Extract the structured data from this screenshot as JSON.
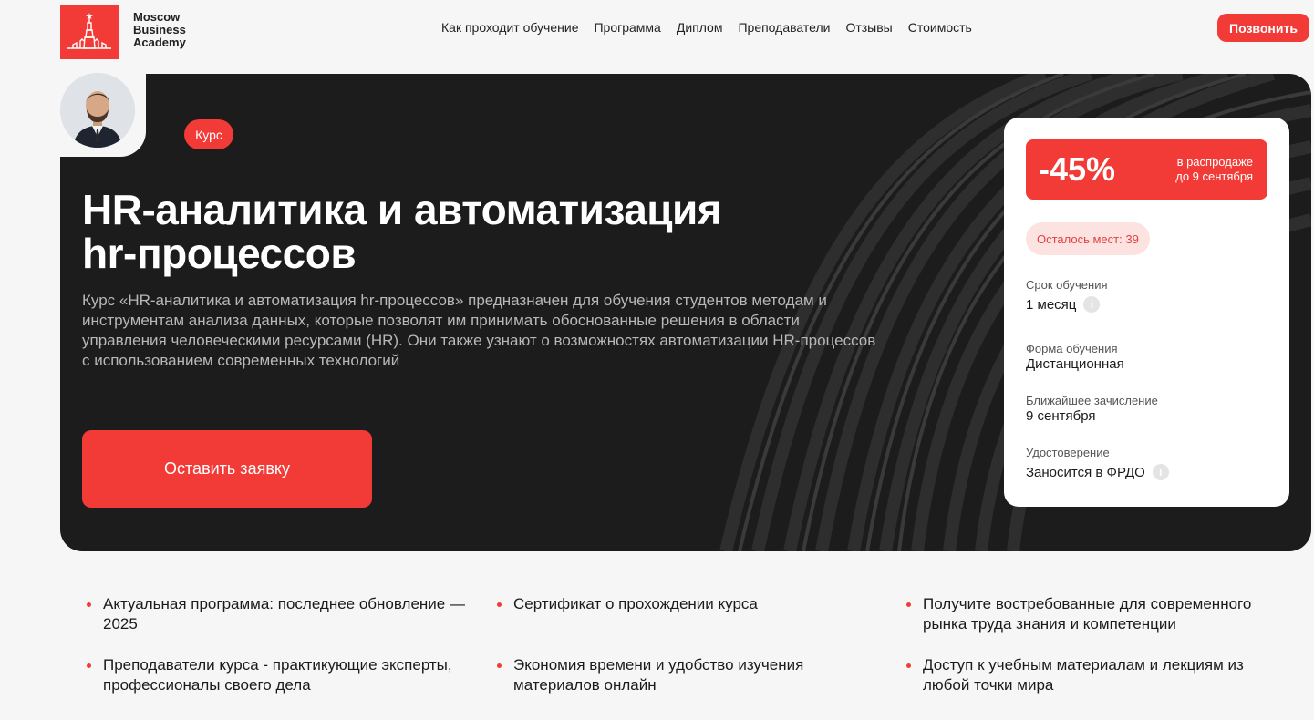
{
  "brand": {
    "line1": "Moscow",
    "line2": "Business",
    "line3": "Academy",
    "color": "#f23a37"
  },
  "nav": [
    {
      "label": "Как проходит обучение"
    },
    {
      "label": "Программа"
    },
    {
      "label": "Диплом"
    },
    {
      "label": "Преподаватели"
    },
    {
      "label": "Отзывы"
    },
    {
      "label": "Стоимость"
    }
  ],
  "header": {
    "call_label": "Позвонить"
  },
  "hero": {
    "badge": "Курс",
    "title_line1": "HR-аналитика и автоматизация",
    "title_line2": "hr-процессов",
    "description": "Курс «HR-аналитика и автоматизация hr-процессов» предназначен для обучения студентов методам и инструментам анализа данных, которые позволят им принимать обоснованные решения в области управления человеческими ресурсами (HR). Они также узнают о возможностях автоматизации HR-процессов с использованием современных технологий",
    "apply_label": "Оставить заявку"
  },
  "card": {
    "discount": "-45%",
    "discount_note_line1": "в распродаже",
    "discount_note_line2": "до 9 сентября",
    "seats": "Осталось мест: 39",
    "duration_label": "Срок обучения",
    "duration_value": "1 месяц",
    "format_label": "Форма обучения",
    "format_value": "Дистанционная",
    "enrollment_label": "Ближайшее зачисление",
    "enrollment_value": "9 сентября",
    "certificate_label": "Удостоверение",
    "certificate_value": "Заносится в ФРДО",
    "info_icon": "i"
  },
  "features": [
    "Актуальная программа: последнее обновление — 2025",
    "Сертификат о прохождении курса",
    "Получите востребованные для современного рынка труда знания и компетенции",
    "Преподаватели курса - практикующие эксперты, профессионалы своего дела",
    "Экономия времени и удобство изучения материалов онлайн",
    "Доступ к учебным материалам и лекциям из любой точки мира"
  ]
}
